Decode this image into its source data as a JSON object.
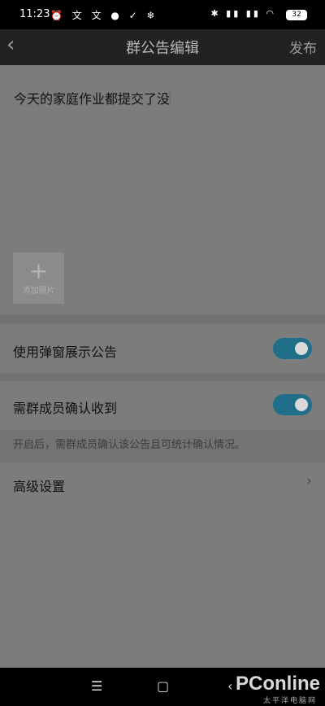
{
  "status": {
    "time": "11:23",
    "left_icons": "⏰ 文 文 ● ✓ ❄",
    "right_icons": "✱ ▮▮ ▮▮ ◠",
    "battery": "32"
  },
  "nav": {
    "back": "‹",
    "title": "群公告编辑",
    "publish": "发布"
  },
  "editor": {
    "text": "今天的家庭作业都提交了没"
  },
  "add_photo": {
    "plus": "+",
    "label": "添加照片"
  },
  "settings": {
    "popup_label": "使用弹窗展示公告",
    "popup_on": true,
    "confirm_label": "需群成员确认收到",
    "confirm_on": true,
    "confirm_hint": "开启后，需群成员确认该公告且可统计确认情况。",
    "advanced_label": "高级设置",
    "chevron": "›"
  },
  "bottom": {
    "menu": "☰",
    "home": "▢",
    "back": "‹"
  },
  "watermark": {
    "brand": "PConline",
    "sub": "太平洋电脑网"
  },
  "colors": {
    "toggle_on": "#1f6f8b",
    "caret": "#3b6fd8"
  }
}
